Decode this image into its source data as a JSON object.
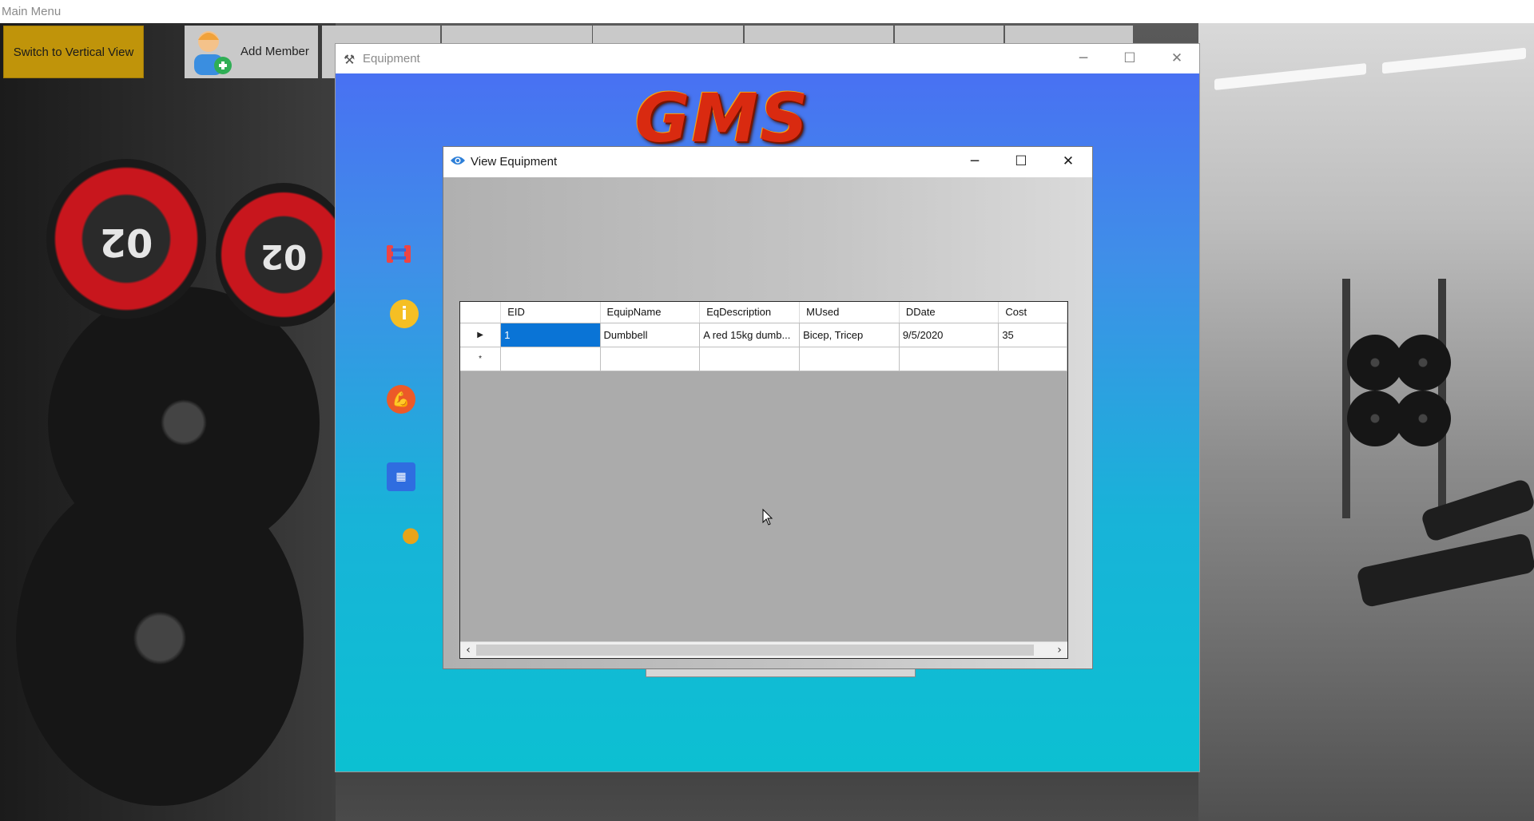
{
  "main_window": {
    "title": "Main Menu"
  },
  "toolbar": {
    "switch_label": "Switch to Vertical View",
    "add_member_label": "Add Member"
  },
  "equipment_window": {
    "title": "Equipment",
    "logo_text": "GMS"
  },
  "view_dialog": {
    "title": "View Equipment",
    "grid": {
      "columns": [
        "EID",
        "EquipName",
        "EqDescription",
        "MUsed",
        "DDate",
        "Cost"
      ],
      "rows": [
        [
          "1",
          "Dumbbell",
          "A red 15kg dumb...",
          "Bicep, Tricep",
          "9/5/2020",
          "35"
        ]
      ]
    }
  },
  "background": {
    "plate_numbers": [
      "02",
      "02"
    ]
  },
  "colors": {
    "switch_button": "#c0940a",
    "selection": "#0a74d6",
    "window_gradient_top": "#4a6cf4",
    "window_gradient_bottom": "#0cc0d2",
    "logo": "#d92a10"
  }
}
